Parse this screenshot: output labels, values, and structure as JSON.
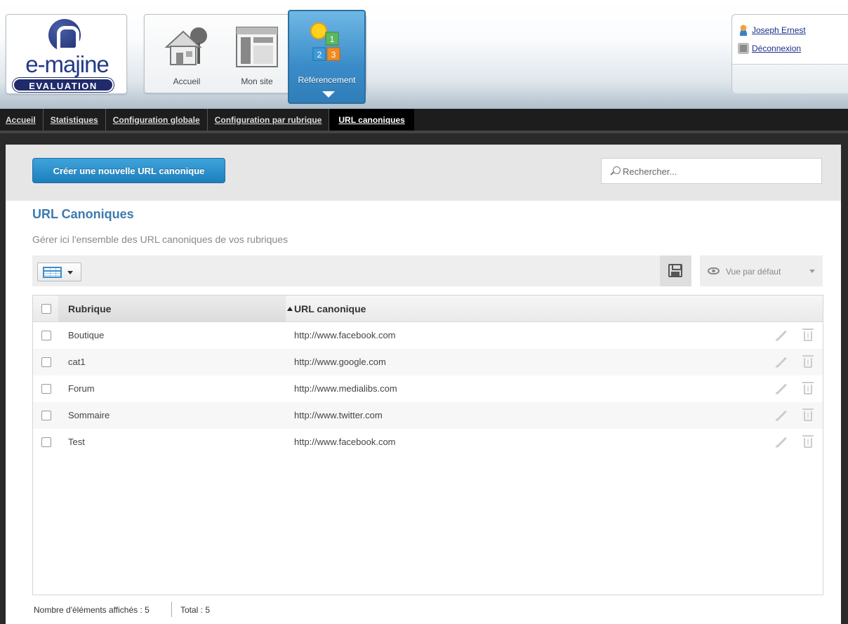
{
  "header": {
    "logo": {
      "brand": "e-majine",
      "badge": "EVALUATION"
    },
    "nav": [
      {
        "label": "Accueil",
        "icon": "house-icon"
      },
      {
        "label": "Mon site",
        "icon": "website-icon"
      },
      {
        "label": "Référencement",
        "icon": "seo-blocks-icon",
        "active": true
      }
    ],
    "user": {
      "name": "Joseph Ernest",
      "logout": "Déconnexion"
    }
  },
  "subnav": {
    "items": [
      "Accueil",
      "Statistiques",
      "Configuration globale",
      "Configuration par rubrique",
      "URL canoniques"
    ],
    "active": "URL canoniques"
  },
  "toolbar": {
    "create_label": "Créer une nouvelle URL canonique",
    "search_placeholder": "Rechercher..."
  },
  "page": {
    "title": "URL Canoniques",
    "subtitle": "Gérer ici l'ensemble des URL canoniques de vos rubriques"
  },
  "grid_toolbar": {
    "view_label": "Vue par défaut"
  },
  "table": {
    "columns": [
      "Rubrique",
      "URL canonique"
    ],
    "rows": [
      {
        "rubrique": "Boutique",
        "url": "http://www.facebook.com"
      },
      {
        "rubrique": "cat1",
        "url": "http://www.google.com"
      },
      {
        "rubrique": "Forum",
        "url": "http://www.medialibs.com"
      },
      {
        "rubrique": "Sommaire",
        "url": "http://www.twitter.com"
      },
      {
        "rubrique": "Test",
        "url": "http://www.facebook.com"
      }
    ]
  },
  "footer": {
    "shown": "Nombre d'éléments affichés : 5",
    "total": "Total : 5"
  },
  "colors": {
    "accent": "#2b8fcf",
    "title": "#3d7ab0",
    "nav_bar": "#1d1d1d"
  }
}
